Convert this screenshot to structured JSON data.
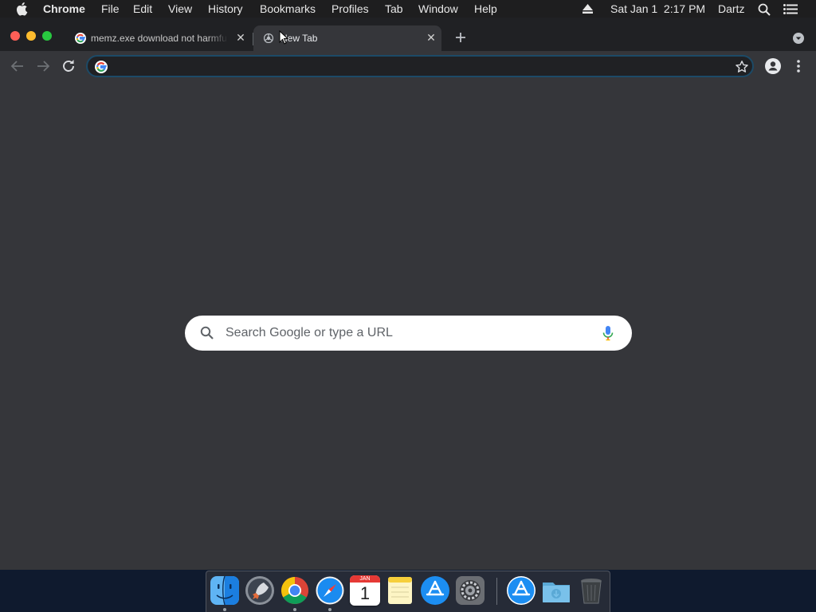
{
  "menubar": {
    "app_name": "Chrome",
    "items": [
      "File",
      "Edit",
      "View",
      "History",
      "Bookmarks",
      "Profiles",
      "Tab",
      "Window",
      "Help"
    ],
    "datetime": "Sat Jan 1  2:17 PM",
    "user": "Dartz"
  },
  "tabs": [
    {
      "title": "memz.exe download not harmful - Google Search",
      "icon": "google-icon",
      "active": false
    },
    {
      "title": "New Tab",
      "icon": "chrome-icon",
      "active": true
    }
  ],
  "omnibox": {
    "value": "",
    "placeholder": ""
  },
  "ntp": {
    "search_placeholder": "Search Google or type a URL"
  },
  "dock": {
    "apps": [
      "finder-icon",
      "launchpad-icon",
      "chrome-icon",
      "safari-icon",
      "calendar-icon",
      "notes-icon",
      "app-store-icon",
      "system-preferences-icon",
      "app-store-icon",
      "downloads-folder-icon",
      "trash-icon"
    ],
    "calendar": {
      "month": "JAN",
      "day": "1"
    }
  },
  "colors": {
    "menubar": "#1e1e1f",
    "tabstrip": "#202124",
    "toolbar": "#35363a",
    "page": "#35363a",
    "omnibox_focus": "#1c4a67"
  }
}
